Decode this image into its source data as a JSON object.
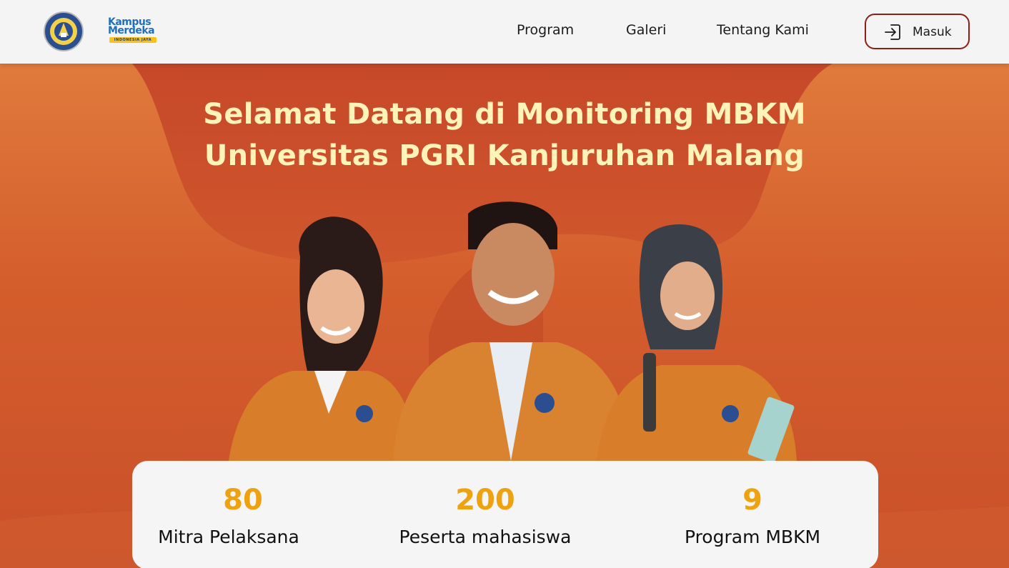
{
  "header": {
    "university_logo": "university-seal-logo",
    "partner_logo": {
      "line1": "Kampus",
      "line2": "Merdeka",
      "tagline": "INDONESIA JAYA"
    },
    "nav": [
      {
        "label": "Program"
      },
      {
        "label": "Galeri"
      },
      {
        "label": "Tentang Kami"
      }
    ],
    "login": {
      "label": "Masuk",
      "icon": "login-icon"
    }
  },
  "hero": {
    "title_line1": "Selamat Datang di Monitoring MBKM",
    "title_line2": "Universitas PGRI Kanjuruhan Malang",
    "image": "students-in-orange-jackets"
  },
  "stats": [
    {
      "value": "80",
      "label": "Mitra Pelaksana"
    },
    {
      "value": "200",
      "label": "Peserta mahasiswa"
    },
    {
      "value": "9",
      "label": "Program MBKM"
    }
  ],
  "colors": {
    "accent_orange": "#d65a2c",
    "title_cream": "#fff3b8",
    "stat_gold": "#efa20f",
    "button_border": "#8f1e16"
  }
}
